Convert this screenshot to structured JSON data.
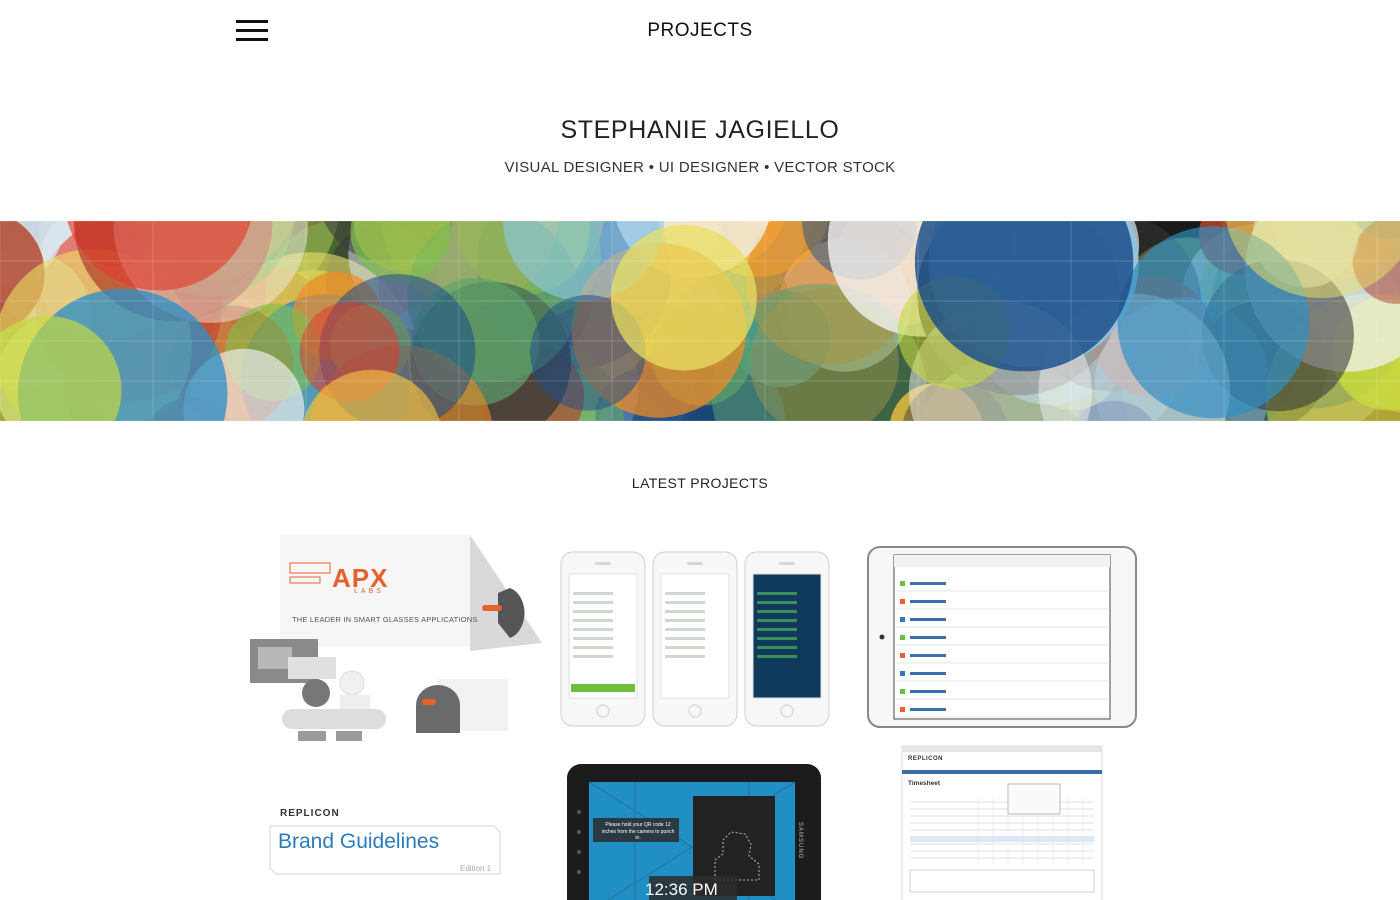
{
  "nav": {
    "menu_icon": "hamburger-menu-icon",
    "title": "PROJECTS"
  },
  "hero": {
    "name": "STEPHANIE JAGIELLO",
    "tagline": "VISUAL DESIGNER • UI DESIGNER • VECTOR STOCK"
  },
  "section": {
    "title": "LATEST PROJECTS"
  },
  "projects": {
    "apx": {
      "logo": "APX",
      "labs": "LABS",
      "tagline": "THE LEADER IN SMART GLASSES APPLICATIONS"
    },
    "brand": {
      "logo": "REPLICON",
      "title": "Brand Guidelines",
      "edition": "Edition 1"
    },
    "tablet": {
      "message": "Please hold your QR code 12 inches from the camera to punch in.",
      "time": "12:36 PM",
      "device": "SAMSUNG"
    },
    "timesheet": {
      "logo": "REPLICON",
      "title": "Timesheet"
    }
  },
  "colors": {
    "accent_orange": "#e8612c",
    "brand_blue": "#2b7bbd",
    "text": "#222222",
    "background": "#ffffff"
  }
}
